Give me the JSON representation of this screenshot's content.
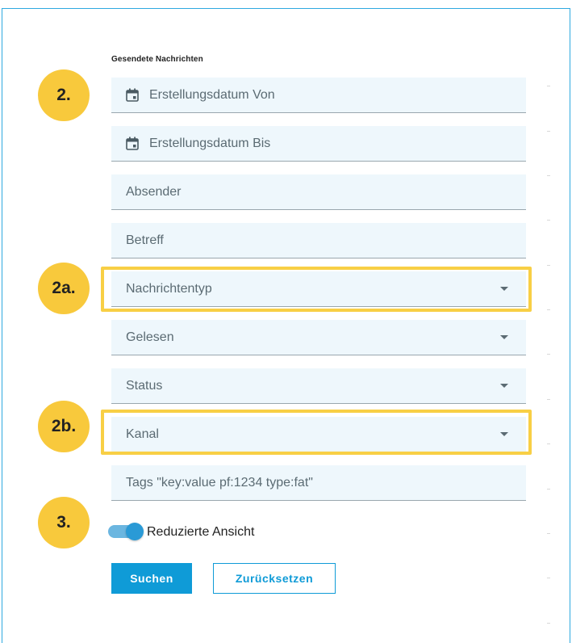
{
  "section": {
    "title": "Gesendete Nachrichten"
  },
  "fields": {
    "date_from": {
      "placeholder": "Erstellungsdatum Von",
      "icon": "calendar-icon"
    },
    "date_to": {
      "placeholder": "Erstellungsdatum Bis",
      "icon": "calendar-icon"
    },
    "sender": {
      "placeholder": "Absender"
    },
    "subject": {
      "placeholder": "Betreff"
    },
    "message_type": {
      "placeholder": "Nachrichtentyp",
      "icon": "chevron-down-icon"
    },
    "read": {
      "placeholder": "Gelesen",
      "icon": "chevron-down-icon"
    },
    "status": {
      "placeholder": "Status",
      "icon": "chevron-down-icon"
    },
    "channel": {
      "placeholder": "Kanal",
      "icon": "chevron-down-icon"
    },
    "tags": {
      "placeholder": "Tags \"key:value pf:1234 type:fat\""
    }
  },
  "badges": {
    "b2": "2.",
    "b2a": "2a.",
    "b2b": "2b.",
    "b3": "3."
  },
  "toggle": {
    "label": "Reduzierte Ansicht",
    "on": true
  },
  "buttons": {
    "search": "Suchen",
    "reset": "Zurücksetzen"
  },
  "colors": {
    "accent": "#0f9bd7",
    "highlight": "#f8cf45",
    "badge": "#f8c93c",
    "field_bg": "#eef7fc",
    "frame": "#2ea9e0"
  }
}
